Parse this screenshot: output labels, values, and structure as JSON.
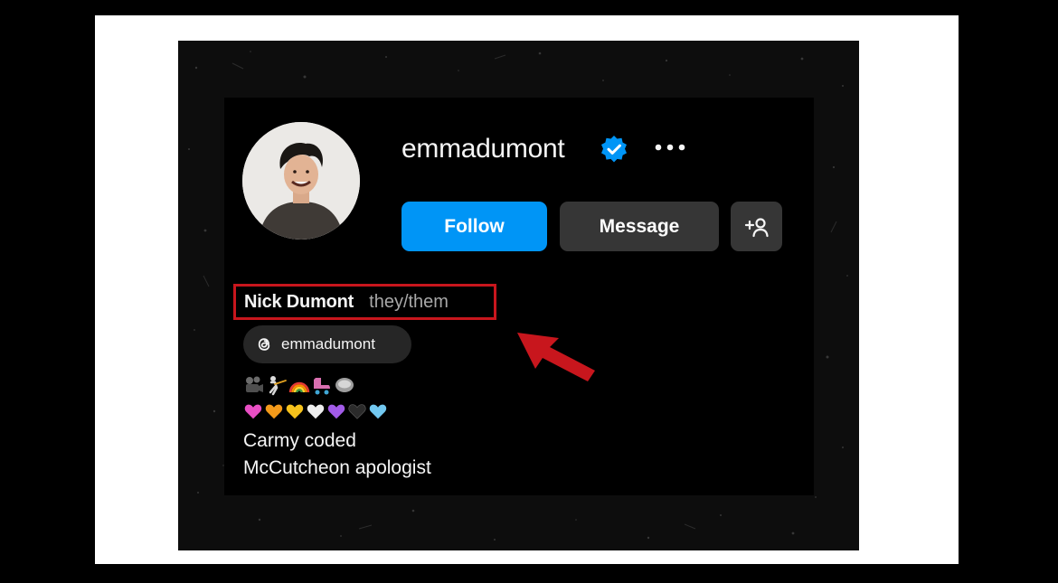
{
  "profile": {
    "username": "emmadumont",
    "verified": true,
    "avatar_alt": "profile-photo",
    "full_name": "Nick Dumont",
    "pronouns": "they/them",
    "threads_handle": "emmadumont",
    "bio_lines": [
      "Carmy coded",
      "McCutcheon apologist"
    ],
    "emoji_row_1": [
      "🎥",
      "🤺",
      "🌈",
      "🛼",
      "🥏"
    ],
    "emoji_row_2": [
      "🩷",
      "🧡",
      "💛",
      "🤍",
      "💜",
      "🖤",
      "🩵"
    ]
  },
  "actions": {
    "follow_label": "Follow",
    "message_label": "Message"
  },
  "icons": {
    "verified": "verified-badge-icon",
    "more": "more-horizontal-icon",
    "add_user": "add-user-icon",
    "threads": "threads-icon",
    "annotation_arrow": "red-arrow-icon"
  },
  "colors": {
    "follow_blue": "#0095f6",
    "secondary_button": "#363636",
    "highlight_red": "#c8161d",
    "text_primary": "#f5f5f5",
    "text_secondary": "#a8a8a8"
  }
}
